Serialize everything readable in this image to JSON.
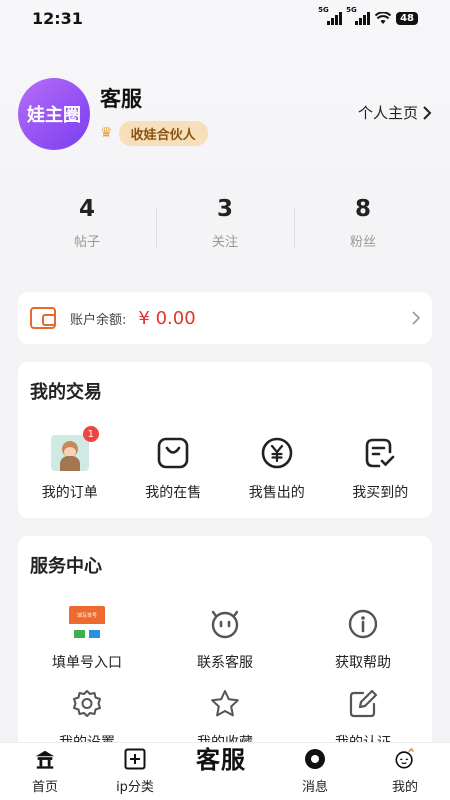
{
  "status_bar": {
    "time": "12:31",
    "network1": "5G",
    "network2": "5G",
    "battery": "48"
  },
  "profile": {
    "avatar_text": "娃主圈",
    "username": "客服",
    "badge": "收娃合伙人",
    "homepage_link": "个人主页"
  },
  "stats": [
    {
      "value": "4",
      "label": "帖子"
    },
    {
      "value": "3",
      "label": "关注"
    },
    {
      "value": "8",
      "label": "粉丝"
    }
  ],
  "balance": {
    "label": "账户余额:",
    "value": "¥ 0.00"
  },
  "trade": {
    "title": "我的交易",
    "items": [
      {
        "label": "我的订单",
        "icon": "order-thumbnail",
        "badge": "1"
      },
      {
        "label": "我的在售",
        "icon": "shopping-bag-icon"
      },
      {
        "label": "我售出的",
        "icon": "yen-icon"
      },
      {
        "label": "我买到的",
        "icon": "checklist-icon"
      }
    ]
  },
  "service": {
    "title": "服务中心",
    "items": [
      {
        "label": "填单号入口",
        "icon": "form-thumbnail",
        "thumb_text": "填写单号"
      },
      {
        "label": "联系客服",
        "icon": "service-icon"
      },
      {
        "label": "获取帮助",
        "icon": "info-icon"
      },
      {
        "label": "我的设置",
        "icon": "gear-icon"
      },
      {
        "label": "我的收藏",
        "icon": "star-icon"
      },
      {
        "label": "我的认证",
        "icon": "edit-icon"
      }
    ]
  },
  "floating_label": "客服",
  "tabbar": [
    {
      "label": "首页",
      "icon": "home-icon"
    },
    {
      "label": "ip分类",
      "icon": "category-icon"
    },
    {
      "label": "",
      "icon": "center-icon"
    },
    {
      "label": "消息",
      "icon": "message-icon"
    },
    {
      "label": "我的",
      "icon": "profile-icon"
    }
  ]
}
